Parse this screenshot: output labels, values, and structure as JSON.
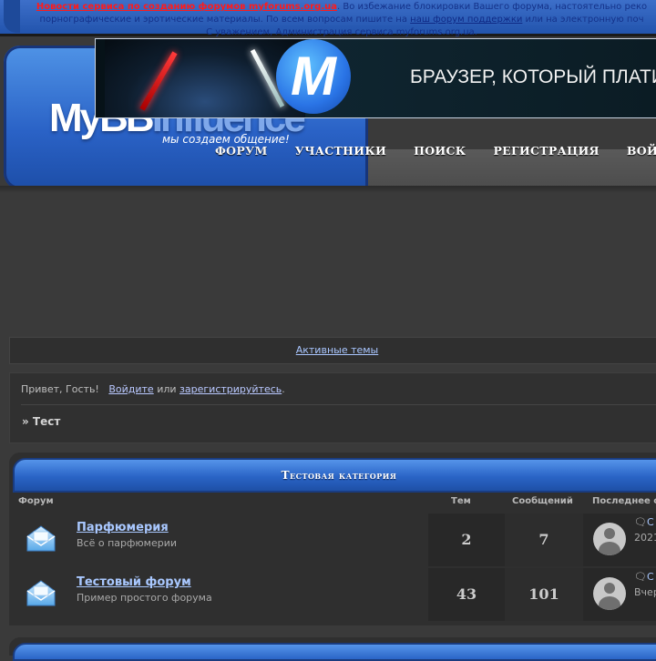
{
  "notice": {
    "link_text": "Новости сервиса по созданию форумов myforums.org.ua",
    "text_1": ". Во избежание блокировки Вашего форума, настоятельно реко",
    "text_2": "порнографические и эротические материалы. По всем вопросам пишите на",
    "support_link": "наш форум поддержки",
    "text_3": "или на электронную поч",
    "text_4": "С уважением, Администрация сервиса myforums.org.ua."
  },
  "header": {
    "logo_main": "MyBB",
    "logo_faded": "Influence",
    "slogan": "мы создаем общение!",
    "ad": {
      "logo_letter": "M",
      "text": "БРАУЗЕР, КОТОРЫЙ ПЛАТИ"
    },
    "nav": [
      "ФОРУМ",
      "УЧАСТНИКИ",
      "ПОИСК",
      "РЕГИСТРАЦИЯ",
      "ВОЙТИ"
    ]
  },
  "active_topics": "Активные темы",
  "welcome": {
    "greeting": "Привет, Гость!",
    "login": "Войдите",
    "or": "или",
    "register": "зарегистрируйтесь",
    "dot": "."
  },
  "breadcrumb": "» Тест",
  "category": {
    "title": "Тестовая категория",
    "columns": {
      "forum": "Форум",
      "topics": "Тем",
      "posts": "Сообщений",
      "last": "Последнее с"
    },
    "forums": [
      {
        "name": "Парфюмерия",
        "desc": "Всё о парфюмерии",
        "topics": "2",
        "posts": "7",
        "last_link": "С",
        "last_date": "2021"
      },
      {
        "name": "Тестовый форум",
        "desc": "Пример простого форума",
        "topics": "43",
        "posts": "101",
        "last_link": "С",
        "last_date": "Вчер"
      }
    ]
  },
  "icons": {
    "forum_icon": "envelope-icon",
    "avatar": "default-avatar-icon",
    "last_post": "speech-bubble-icon"
  },
  "colors": {
    "page_bg": "#3a3a3a",
    "header_blue": "#2a62c6",
    "link": "#a9c8ff",
    "alert_red": "#ff1b1b"
  }
}
